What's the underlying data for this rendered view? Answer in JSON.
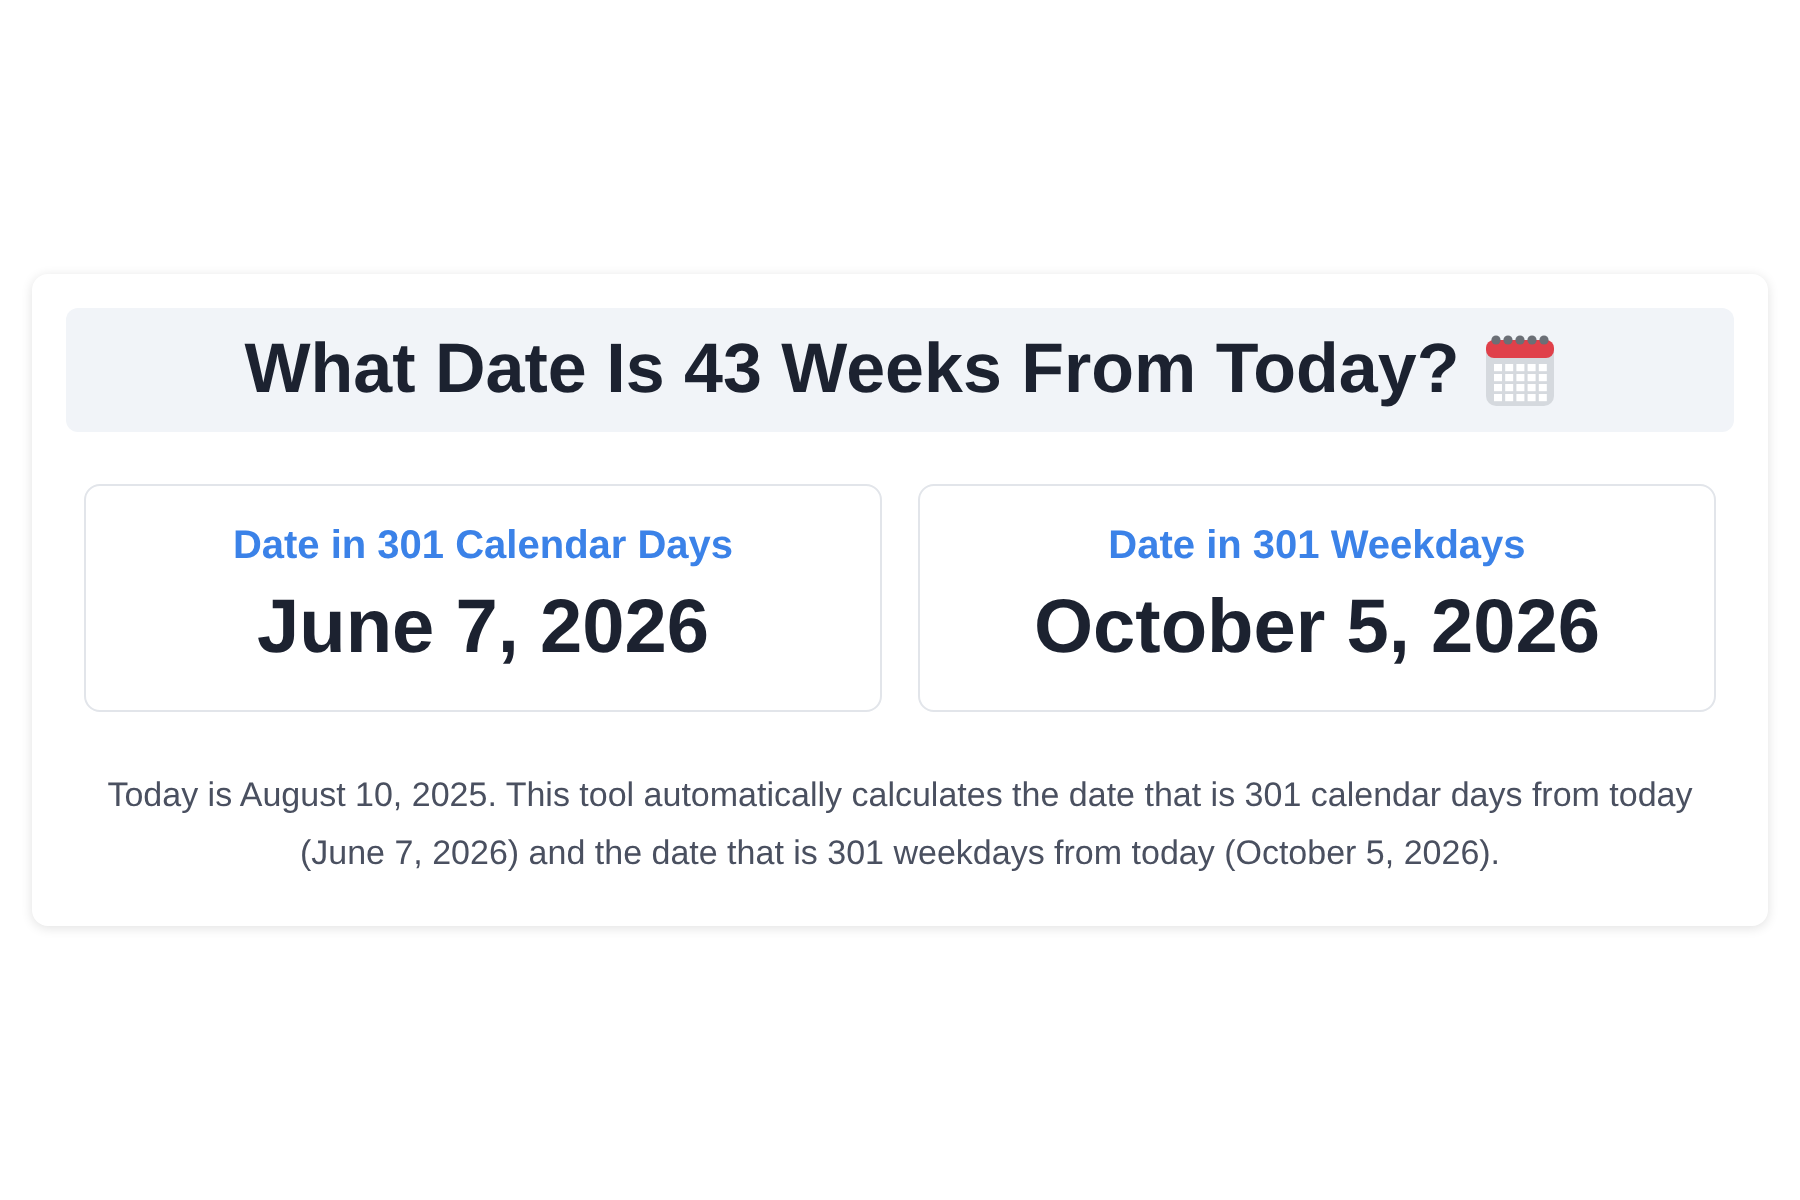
{
  "title": "What Date Is 43 Weeks From Today?",
  "results": [
    {
      "label": "Date in 301 Calendar Days",
      "date": "June 7, 2026"
    },
    {
      "label": "Date in 301 Weekdays",
      "date": "October 5, 2026"
    }
  ],
  "description": "Today is August 10, 2025. This tool automatically calculates the date that is 301 calendar days from today (June 7, 2026) and the date that is 301 weekdays from today (October 5, 2026)."
}
